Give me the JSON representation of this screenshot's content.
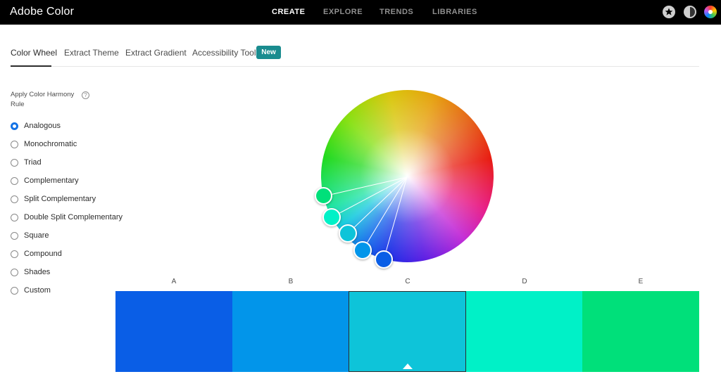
{
  "app": {
    "title": "Adobe Color"
  },
  "nav": {
    "items": [
      {
        "label": "CREATE",
        "active": true
      },
      {
        "label": "EXPLORE",
        "active": false
      },
      {
        "label": "TRENDS",
        "active": false
      },
      {
        "label": "LIBRARIES",
        "active": false
      }
    ],
    "icons": [
      "star-badge-icon",
      "contrast-icon",
      "color-wheel-profile-icon"
    ]
  },
  "tabs": [
    {
      "label": "Color Wheel",
      "active": true
    },
    {
      "label": "Extract Theme",
      "active": false
    },
    {
      "label": "Extract Gradient",
      "active": false
    },
    {
      "label": "Accessibility Tools",
      "active": false
    }
  ],
  "badge": {
    "label": "New",
    "color": "#1a8c8f"
  },
  "harmony": {
    "title": "Apply Color Harmony Rule",
    "help_symbol": "?",
    "rules": [
      {
        "label": "Analogous",
        "selected": true
      },
      {
        "label": "Monochromatic",
        "selected": false
      },
      {
        "label": "Triad",
        "selected": false
      },
      {
        "label": "Complementary",
        "selected": false
      },
      {
        "label": "Split Complementary",
        "selected": false
      },
      {
        "label": "Double Split Complementary",
        "selected": false
      },
      {
        "label": "Square",
        "selected": false
      },
      {
        "label": "Compound",
        "selected": false
      },
      {
        "label": "Shades",
        "selected": false
      },
      {
        "label": "Custom",
        "selected": false
      }
    ]
  },
  "swatches": [
    {
      "label": "A",
      "color": "#0a5ee6",
      "selected": false
    },
    {
      "label": "B",
      "color": "#0295ea",
      "selected": false
    },
    {
      "label": "C",
      "color": "#0ec4d9",
      "selected": true
    },
    {
      "label": "D",
      "color": "#00f1c7",
      "selected": false
    },
    {
      "label": "E",
      "color": "#00e07a",
      "selected": false
    }
  ],
  "colors": {
    "accent": "#1473e6",
    "topbar": "#000000"
  }
}
